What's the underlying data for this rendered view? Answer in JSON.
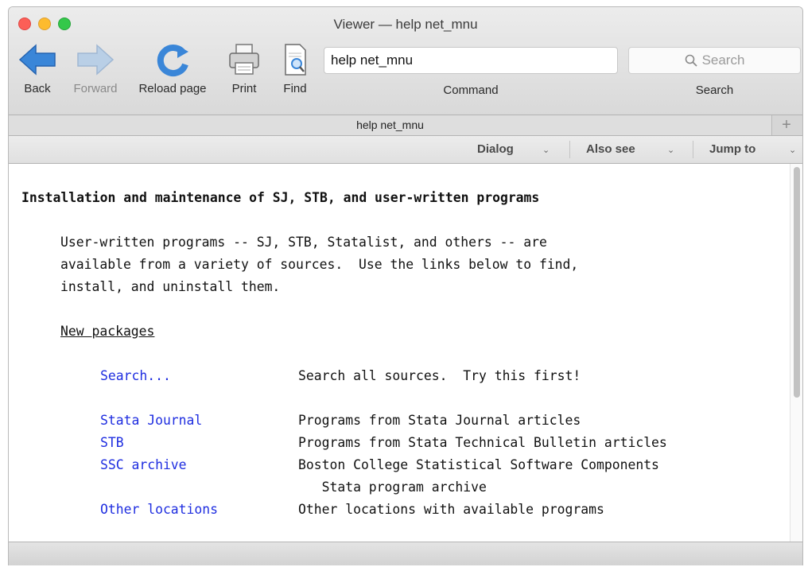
{
  "window": {
    "title": "Viewer — help net_mnu"
  },
  "toolbar": {
    "back": "Back",
    "forward": "Forward",
    "reload": "Reload page",
    "print": "Print",
    "find": "Find",
    "command_value": "help net_mnu",
    "command_label": "Command",
    "search_placeholder": "Search",
    "search_label": "Search"
  },
  "tabs": [
    {
      "label": "help net_mnu"
    }
  ],
  "tab_add": "+",
  "viewbar": {
    "dialog": "Dialog",
    "also_see": "Also see",
    "jump_to": "Jump to"
  },
  "content": {
    "heading": "Installation and maintenance of SJ, STB, and user-written programs",
    "intro": [
      "User-written programs -- SJ, STB, Statalist, and others -- are",
      "available from a variety of sources.  Use the links below to find,",
      "install, and uninstall them."
    ],
    "section": "New packages",
    "rows": [
      {
        "link": "Search...",
        "desc": "Search all sources.  Try this first!"
      },
      {
        "link": "Stata Journal",
        "desc": "Programs from Stata Journal articles"
      },
      {
        "link": "STB",
        "desc": "Programs from Stata Technical Bulletin articles"
      },
      {
        "link": "SSC archive",
        "desc": "Boston College Statistical Software Components"
      },
      {
        "link": "",
        "desc": "   Stata program archive"
      },
      {
        "link": "Other locations",
        "desc": "Other locations with available programs"
      }
    ]
  },
  "colors": {
    "link": "#1e2de0",
    "icon_blue": "#3a86d8"
  }
}
